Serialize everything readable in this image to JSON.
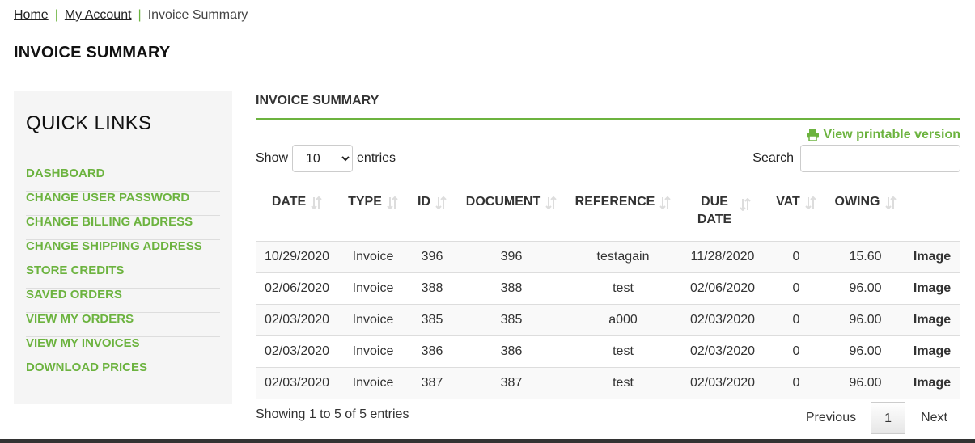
{
  "breadcrumb": {
    "home": "Home",
    "separator": "|",
    "account": "My Account",
    "current": "Invoice Summary"
  },
  "page_title": "INVOICE SUMMARY",
  "sidebar": {
    "title": "QUICK LINKS",
    "items": [
      {
        "label": "DASHBOARD"
      },
      {
        "label": "CHANGE USER PASSWORD"
      },
      {
        "label": "CHANGE BILLING ADDRESS"
      },
      {
        "label": "CHANGE SHIPPING ADDRESS"
      },
      {
        "label": "STORE CREDITS"
      },
      {
        "label": "SAVED ORDERS"
      },
      {
        "label": "VIEW MY ORDERS"
      },
      {
        "label": "VIEW MY INVOICES"
      },
      {
        "label": "DOWNLOAD PRICES"
      }
    ]
  },
  "main": {
    "title": "INVOICE SUMMARY",
    "print_label": "View printable version",
    "print_icon": "printer-icon",
    "show_label": "Show",
    "show_value": "10",
    "entries_label": "entries",
    "search_label": "Search",
    "search_value": ""
  },
  "table": {
    "headers": [
      "DATE",
      "TYPE",
      "ID",
      "DOCUMENT",
      "REFERENCE",
      "DUE DATE",
      "VAT",
      "OWING"
    ],
    "rows": [
      {
        "date": "10/29/2020",
        "type": "Invoice",
        "id": "396",
        "document": "396",
        "reference": "testagain",
        "due": "11/28/2020",
        "vat": "0",
        "owing": "15.60",
        "link": "Image"
      },
      {
        "date": "02/06/2020",
        "type": "Invoice",
        "id": "388",
        "document": "388",
        "reference": "test",
        "due": "02/06/2020",
        "vat": "0",
        "owing": "96.00",
        "link": "Image"
      },
      {
        "date": "02/03/2020",
        "type": "Invoice",
        "id": "385",
        "document": "385",
        "reference": "a000",
        "due": "02/03/2020",
        "vat": "0",
        "owing": "96.00",
        "link": "Image"
      },
      {
        "date": "02/03/2020",
        "type": "Invoice",
        "id": "386",
        "document": "386",
        "reference": "test",
        "due": "02/03/2020",
        "vat": "0",
        "owing": "96.00",
        "link": "Image"
      },
      {
        "date": "02/03/2020",
        "type": "Invoice",
        "id": "387",
        "document": "387",
        "reference": "test",
        "due": "02/03/2020",
        "vat": "0",
        "owing": "96.00",
        "link": "Image"
      }
    ]
  },
  "footer": {
    "info": "Showing 1 to 5 of 5 entries",
    "previous": "Previous",
    "current_page": "1",
    "next": "Next"
  },
  "colors": {
    "accent": "#6cb33f",
    "sidebar_bg": "#f5f5f5"
  }
}
